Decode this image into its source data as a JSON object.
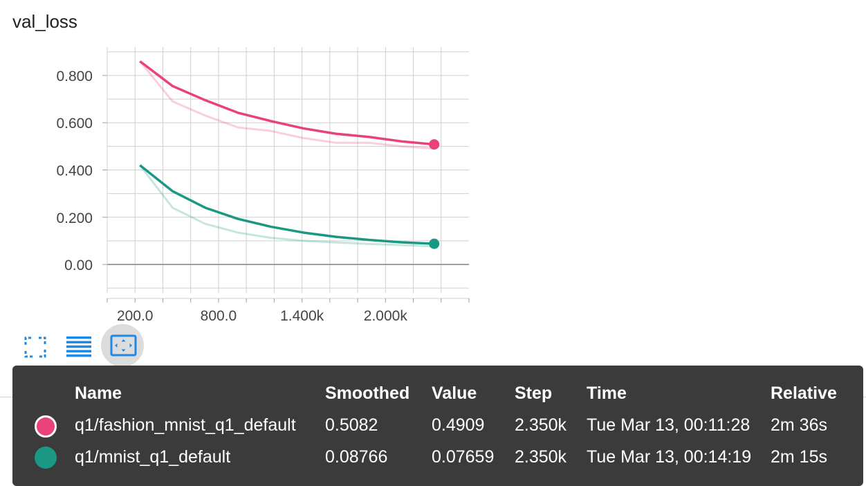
{
  "card": {
    "title": "val_loss"
  },
  "chart_data": {
    "type": "line",
    "title": "val_loss",
    "xlabel": "",
    "ylabel": "",
    "xlim": [
      0,
      2600
    ],
    "ylim": [
      -0.12,
      0.92
    ],
    "x_ticks": [
      200,
      800,
      1400,
      2000
    ],
    "x_tick_labels": [
      "200.0",
      "800.0",
      "1.400k",
      "2.000k"
    ],
    "y_ticks": [
      0,
      0.2,
      0.4,
      0.6,
      0.8
    ],
    "y_tick_labels": [
      "0.00",
      "0.200",
      "0.400",
      "0.600",
      "0.800"
    ],
    "grid": true,
    "series": [
      {
        "name": "q1/fashion_mnist_q1_default",
        "color": "#e8417b",
        "x": [
          235,
          470,
          705,
          940,
          1175,
          1410,
          1645,
          1880,
          2115,
          2350
        ],
        "smoothed": [
          0.86,
          0.755,
          0.695,
          0.642,
          0.607,
          0.576,
          0.553,
          0.54,
          0.521,
          0.5082
        ],
        "values": [
          0.86,
          0.69,
          0.63,
          0.58,
          0.565,
          0.535,
          0.515,
          0.515,
          0.5,
          0.4909
        ]
      },
      {
        "name": "q1/mnist_q1_default",
        "color": "#1a9883",
        "x": [
          235,
          470,
          705,
          940,
          1175,
          1410,
          1645,
          1880,
          2115,
          2350
        ],
        "smoothed": [
          0.42,
          0.31,
          0.24,
          0.193,
          0.16,
          0.135,
          0.117,
          0.104,
          0.094,
          0.08766
        ],
        "values": [
          0.42,
          0.24,
          0.172,
          0.135,
          0.113,
          0.1,
          0.093,
          0.087,
          0.082,
          0.07659
        ]
      }
    ]
  },
  "toolbar": {
    "buttons": [
      {
        "icon": "fullscreen-icon",
        "active": false
      },
      {
        "icon": "list-icon",
        "active": false
      },
      {
        "icon": "fit-domain-icon",
        "active": true
      }
    ],
    "color": "#1e88e5"
  },
  "tooltip": {
    "headers": {
      "name": "Name",
      "smoothed": "Smoothed",
      "value": "Value",
      "step": "Step",
      "time": "Time",
      "relative": "Relative"
    },
    "rows": [
      {
        "color": "#e8417b",
        "name": "q1/fashion_mnist_q1_default",
        "smoothed": "0.5082",
        "value": "0.4909",
        "step": "2.350k",
        "time": "Tue Mar 13, 00:11:28",
        "relative": "2m 36s"
      },
      {
        "color": "#1a9883",
        "name": "q1/mnist_q1_default",
        "smoothed": "0.08766",
        "value": "0.07659",
        "step": "2.350k",
        "time": "Tue Mar 13, 00:14:19",
        "relative": "2m 15s"
      }
    ]
  }
}
